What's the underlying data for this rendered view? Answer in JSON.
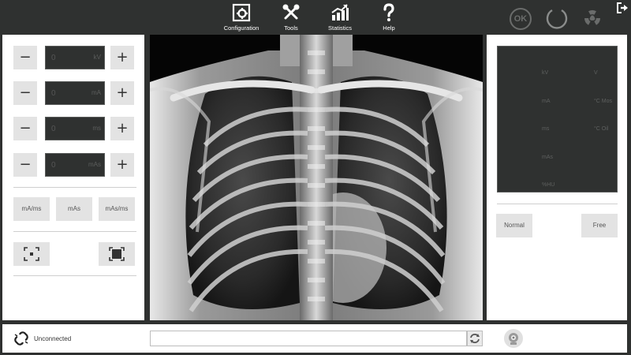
{
  "toolbar": {
    "configuration": "Configuration",
    "tools": "Tools",
    "statistics": "Statistics",
    "help": "Help",
    "ok": "OK"
  },
  "params": [
    {
      "value": "0",
      "unit": "kV"
    },
    {
      "value": "0",
      "unit": "mA"
    },
    {
      "value": "0",
      "unit": "ms"
    },
    {
      "value": "0",
      "unit": "mAs"
    }
  ],
  "modes": [
    "mA/ms",
    "mAs",
    "mAs/ms"
  ],
  "status": {
    "kv": "kV",
    "v": "V",
    "ma": "mA",
    "mos": "°C  Mos",
    "ms": "ms",
    "oil": "°C  Oil",
    "mas": "mAs",
    "hu": "%HU"
  },
  "right_buttons": {
    "normal": "Normal",
    "free": "Free"
  },
  "bottom": {
    "connection": "Unconnected",
    "message": ""
  },
  "colors": {
    "background": "#2f3130",
    "panel": "#ffffff",
    "button": "#e3e3e3"
  }
}
